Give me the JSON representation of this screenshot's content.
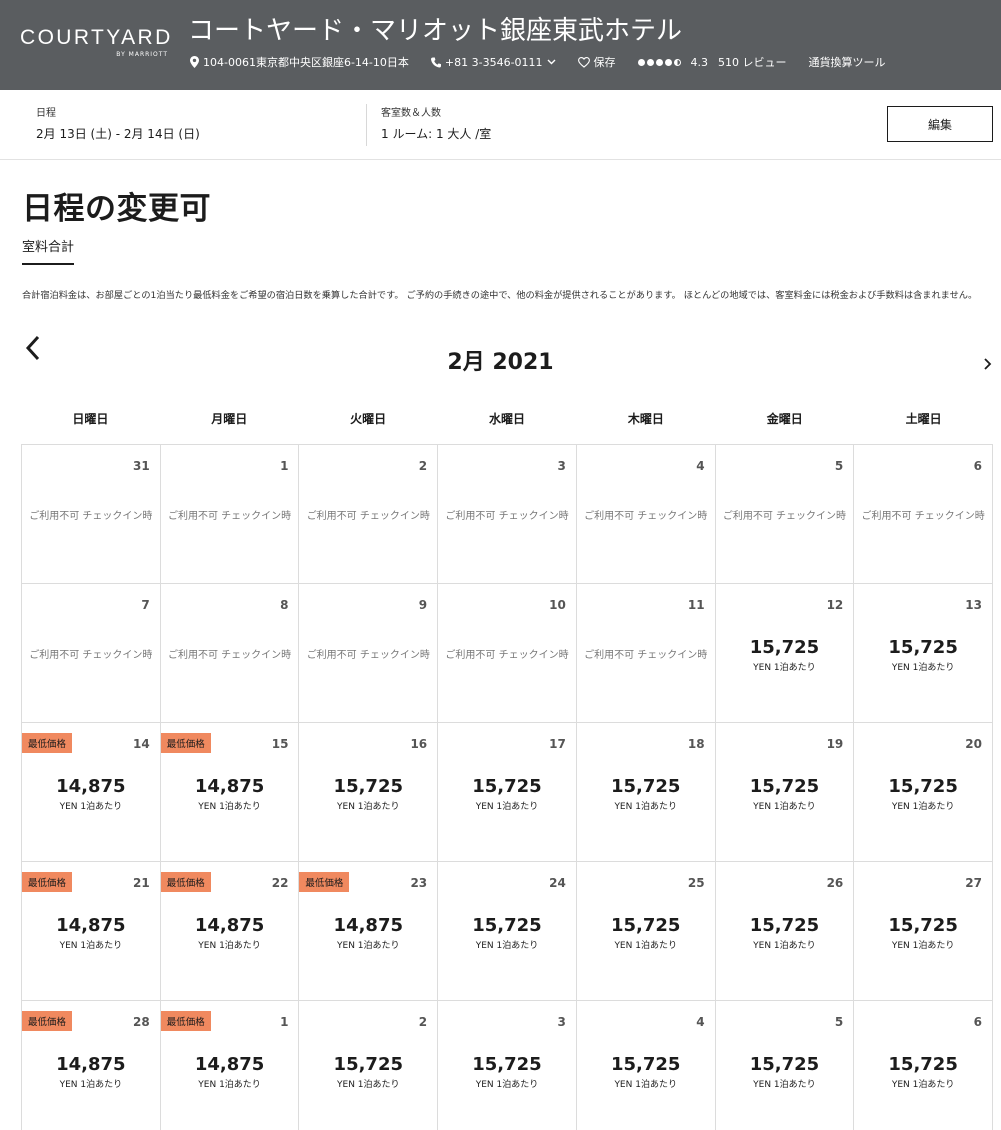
{
  "header": {
    "logo_word": "COURTYARD",
    "logo_by": "BY MARRIOTT",
    "hotel_name": "コートヤード・マリオット銀座東武ホテル",
    "address": "104-0061東京都中央区銀座6-14-10日本",
    "phone": "+81 3-3546-0111",
    "save_label": "保存",
    "rating": "4.3",
    "reviews": "510 レビュー",
    "currency_tool": "通貨換算ツール"
  },
  "search": {
    "dates_label": "日程",
    "dates_value": "2月 13日 (土) - 2月 14日 (日)",
    "guests_label": "客室数＆人数",
    "guests_value": "1 ルーム: 1 大人 /室",
    "edit_label": "編集"
  },
  "page": {
    "title": "日程の変更可",
    "tab": "室料合計",
    "note": "合計宿泊料金は、お部屋ごとの1泊当たり最低料金をご希望の宿泊日数を乗算した合計です。 ご予約の手続きの途中で、他の料金が提供されることがあります。 ほとんどの地域では、客室料金には税金および手数料は含まれません。"
  },
  "calendar": {
    "month_title": "2月 2021",
    "weekdays": [
      "日曜日",
      "月曜日",
      "火曜日",
      "水曜日",
      "木曜日",
      "金曜日",
      "土曜日"
    ],
    "unavailable_text": "ご利用不可 チェックイン時",
    "price_unit": "YEN 1泊あたり",
    "badge_text": "最低価格",
    "accent_color": "#f0895f",
    "days": [
      {
        "day": "31",
        "status": "unavailable"
      },
      {
        "day": "1",
        "status": "unavailable"
      },
      {
        "day": "2",
        "status": "unavailable"
      },
      {
        "day": "3",
        "status": "unavailable"
      },
      {
        "day": "4",
        "status": "unavailable"
      },
      {
        "day": "5",
        "status": "unavailable"
      },
      {
        "day": "6",
        "status": "unavailable"
      },
      {
        "day": "7",
        "status": "unavailable"
      },
      {
        "day": "8",
        "status": "unavailable"
      },
      {
        "day": "9",
        "status": "unavailable"
      },
      {
        "day": "10",
        "status": "unavailable"
      },
      {
        "day": "11",
        "status": "unavailable"
      },
      {
        "day": "12",
        "price": "15,725"
      },
      {
        "day": "13",
        "price": "15,725"
      },
      {
        "day": "14",
        "price": "14,875",
        "lowest": true
      },
      {
        "day": "15",
        "price": "14,875",
        "lowest": true
      },
      {
        "day": "16",
        "price": "15,725"
      },
      {
        "day": "17",
        "price": "15,725"
      },
      {
        "day": "18",
        "price": "15,725"
      },
      {
        "day": "19",
        "price": "15,725"
      },
      {
        "day": "20",
        "price": "15,725"
      },
      {
        "day": "21",
        "price": "14,875",
        "lowest": true
      },
      {
        "day": "22",
        "price": "14,875",
        "lowest": true
      },
      {
        "day": "23",
        "price": "14,875",
        "lowest": true
      },
      {
        "day": "24",
        "price": "15,725"
      },
      {
        "day": "25",
        "price": "15,725"
      },
      {
        "day": "26",
        "price": "15,725"
      },
      {
        "day": "27",
        "price": "15,725"
      },
      {
        "day": "28",
        "price": "14,875",
        "lowest": true
      },
      {
        "day": "1",
        "price": "14,875",
        "lowest": true
      },
      {
        "day": "2",
        "price": "15,725"
      },
      {
        "day": "3",
        "price": "15,725"
      },
      {
        "day": "4",
        "price": "15,725"
      },
      {
        "day": "5",
        "price": "15,725"
      },
      {
        "day": "6",
        "price": "15,725"
      }
    ]
  }
}
